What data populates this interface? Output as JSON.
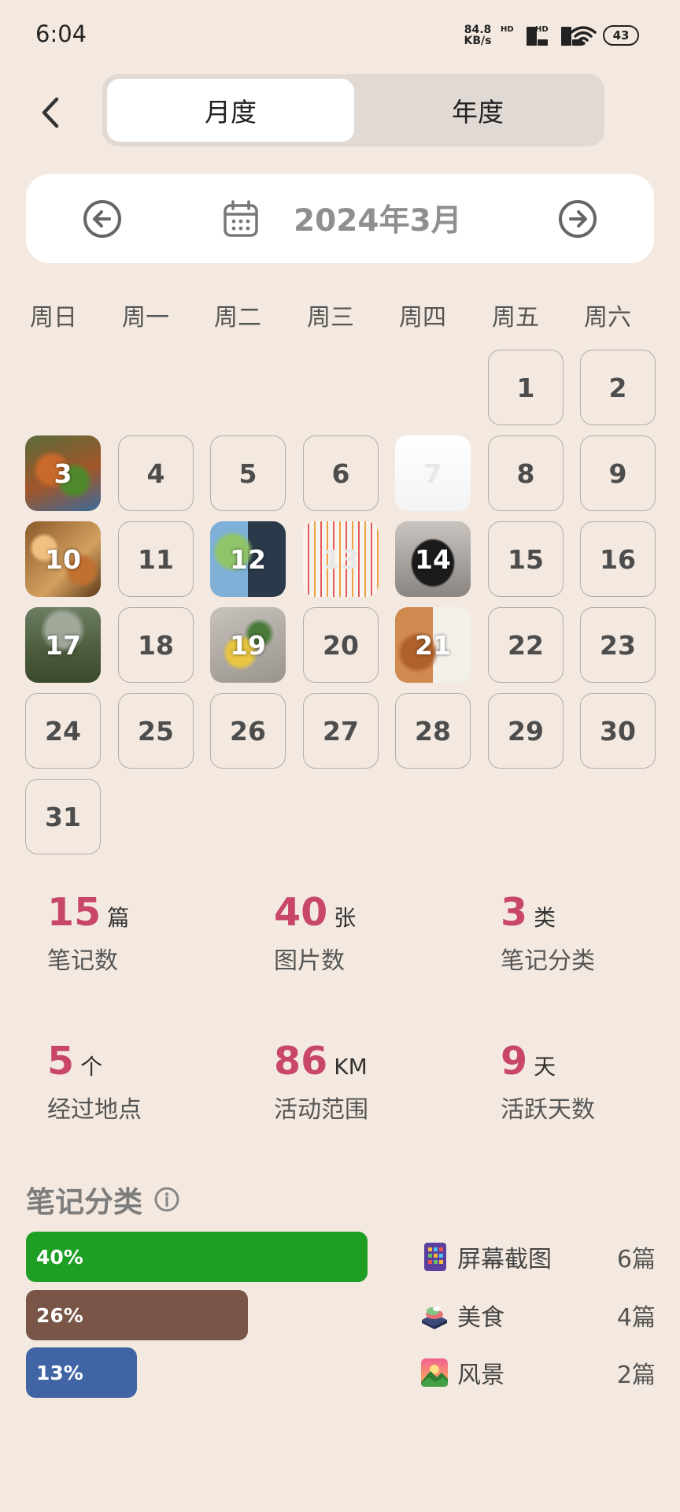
{
  "status": {
    "time": "6:04",
    "net_speed_value": "84.8",
    "net_speed_unit": "KB/s",
    "hd_label": "HD",
    "battery": "43"
  },
  "header": {
    "tabs": [
      "月度",
      "年度"
    ],
    "active_tab": "月度"
  },
  "month_nav": {
    "label": "2024年3月"
  },
  "calendar": {
    "weekdays": [
      "周日",
      "周一",
      "周二",
      "周三",
      "周四",
      "周五",
      "周六"
    ],
    "first_weekday_index": 5,
    "days_in_month": 31,
    "days_with_photos": [
      3,
      7,
      10,
      12,
      13,
      14,
      17,
      19,
      21
    ]
  },
  "stats": [
    {
      "value": "15",
      "unit": "篇",
      "label": "笔记数"
    },
    {
      "value": "40",
      "unit": "张",
      "label": "图片数"
    },
    {
      "value": "3",
      "unit": "类",
      "label": "笔记分类"
    },
    {
      "value": "5",
      "unit": "个",
      "label": "经过地点"
    },
    {
      "value": "86",
      "unit": "KM",
      "label": "活动范围"
    },
    {
      "value": "9",
      "unit": "天",
      "label": "活跃天数"
    }
  ],
  "categories": {
    "title": "笔记分类",
    "items": [
      {
        "percent_label": "40%",
        "fraction": 0.4,
        "color": "#1f9e24",
        "name": "屏幕截图",
        "count": "6篇",
        "icon": "screenshot-icon"
      },
      {
        "percent_label": "26%",
        "fraction": 0.26,
        "color": "#795548",
        "name": "美食",
        "count": "4篇",
        "icon": "food-icon"
      },
      {
        "percent_label": "13%",
        "fraction": 0.13,
        "color": "#4164a5",
        "name": "风景",
        "count": "2篇",
        "icon": "landscape-icon"
      }
    ]
  }
}
